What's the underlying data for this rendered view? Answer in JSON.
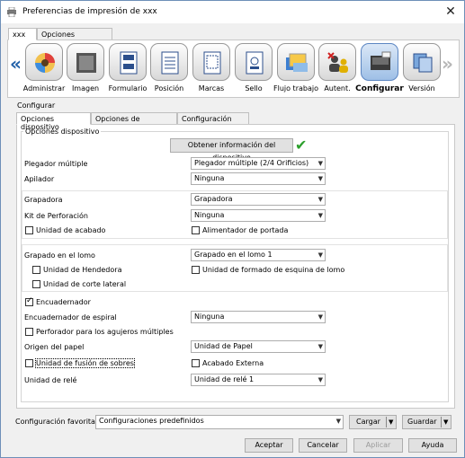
{
  "window": {
    "title": "Preferencias de impresión de xxx",
    "close_glyph": "✕"
  },
  "top_tabs": [
    "xxx",
    "Opciones avanzadas"
  ],
  "toolbar": {
    "nav_left": "«",
    "nav_right": "»",
    "items": [
      {
        "label": "Administrar",
        "icon": "palette-icon"
      },
      {
        "label": "Imagen",
        "icon": "image-icon"
      },
      {
        "label": "Formulario",
        "icon": "form-icon"
      },
      {
        "label": "Posición",
        "icon": "position-icon"
      },
      {
        "label": "Marcas",
        "icon": "marks-icon"
      },
      {
        "label": "Sello",
        "icon": "stamp-icon"
      },
      {
        "label": "Flujo trabajo",
        "icon": "workflow-icon"
      },
      {
        "label": "Autent.",
        "icon": "authentication-icon"
      },
      {
        "label": "Configurar",
        "icon": "printer-config-icon"
      },
      {
        "label": "Versión",
        "icon": "version-icon"
      }
    ],
    "active_index": 8
  },
  "group_label": "Configurar",
  "sub_tabs": [
    "Opciones dispositivo",
    "Opciones de controlador",
    "Configuración SNMP"
  ],
  "options_device": {
    "title": "Opciones dispositivo",
    "get_info_button": "Obtener información del dispositivo",
    "rows": {
      "plegador_label": "Plegador múltiple",
      "plegador_value": "Plegador múltiple (2/4 Orificios)",
      "apilador_label": "Apilador",
      "apilador_value": "Ninguna",
      "grapadora_label": "Grapadora",
      "grapadora_value": "Grapadora",
      "kit_label": "Kit de Perforación",
      "kit_value": "Ninguna",
      "unidad_acabado": "Unidad de acabado",
      "alimentador_portada": "Alimentador de portada",
      "grapado_lomo_label": "Grapado en el lomo",
      "grapado_lomo_value": "Grapado en el lomo 1",
      "unidad_hendedora": "Unidad de Hendedora",
      "unidad_formado": "Unidad de formado de esquina de lomo",
      "unidad_corte": "Unidad de corte lateral",
      "encuadernador": "Encuadernador",
      "encuadernador_espiral_label": "Encuadernador de espiral",
      "encuadernador_espiral_value": "Ninguna",
      "perforador": "Perforador para los agujeros múltiples",
      "origen_label": "Origen del papel",
      "origen_value": "Unidad de Papel",
      "fusion_sobres": "Unidad de fusión de sobres",
      "acabado_externa": "Acabado Externa",
      "unidad_rele_label": "Unidad de relé",
      "unidad_rele_value": "Unidad de relé 1"
    }
  },
  "favorites": {
    "label": "Configuración favorita",
    "value": "Configuraciones predefinidos",
    "load": "Cargar",
    "save": "Guardar"
  },
  "buttons": {
    "accept": "Aceptar",
    "cancel": "Cancelar",
    "apply": "Aplicar",
    "help": "Ayuda"
  },
  "colors": {
    "accent": "#1f5fa8",
    "success_check": "#2ca02c"
  }
}
